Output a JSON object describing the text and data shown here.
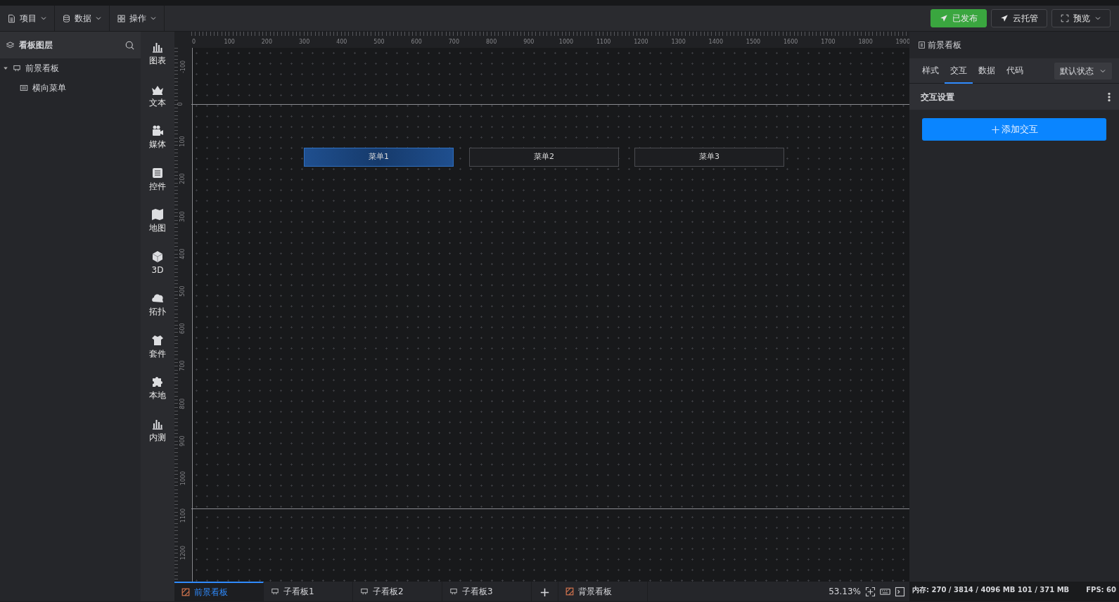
{
  "toolbar": {
    "menus": [
      {
        "label": "项目"
      },
      {
        "label": "数据"
      },
      {
        "label": "操作"
      }
    ],
    "actions": [
      {
        "label": "已发布",
        "kind": "primary"
      },
      {
        "label": "云托管",
        "kind": "outline"
      },
      {
        "label": "预览",
        "kind": "dropdown"
      }
    ]
  },
  "layers": {
    "title": "看板图层",
    "tree": [
      {
        "label": "前景看板",
        "expanded": true,
        "children": [
          {
            "label": "横向菜单"
          }
        ]
      }
    ]
  },
  "palette": [
    {
      "label": "图表"
    },
    {
      "label": "文本"
    },
    {
      "label": "媒体"
    },
    {
      "label": "控件"
    },
    {
      "label": "地图"
    },
    {
      "label": "3D"
    },
    {
      "label": "拓扑"
    },
    {
      "label": "套件"
    },
    {
      "label": "本地"
    },
    {
      "label": "内测"
    }
  ],
  "ruler": {
    "x_labels": [
      "0",
      "100",
      "200",
      "300",
      "400",
      "500",
      "600",
      "700",
      "800",
      "900",
      "1000",
      "1100",
      "1200",
      "1300",
      "1400",
      "1500",
      "1600",
      "1700",
      "1800",
      "1900"
    ],
    "y_labels": [
      "-100",
      "0",
      "100",
      "200",
      "300",
      "400",
      "500",
      "600",
      "700",
      "800",
      "900",
      "1000",
      "1100",
      "1200"
    ]
  },
  "canvas": {
    "menu_items": [
      {
        "label": "菜单1",
        "selected": true
      },
      {
        "label": "菜单2",
        "selected": false
      },
      {
        "label": "菜单3",
        "selected": false
      }
    ]
  },
  "board_tabs": [
    {
      "label": "前景看板",
      "kind": "board",
      "selected": true
    },
    {
      "label": "子看板1",
      "kind": "sub",
      "selected": false
    },
    {
      "label": "子看板2",
      "kind": "sub",
      "selected": false
    },
    {
      "label": "子看板3",
      "kind": "sub",
      "selected": false
    },
    {
      "label": "+",
      "kind": "add"
    },
    {
      "label": "背景看板",
      "kind": "board",
      "selected": false
    }
  ],
  "zoom": "53.13%",
  "panel": {
    "title": "前景看板",
    "tabs": [
      {
        "label": "样式",
        "selected": false
      },
      {
        "label": "交互",
        "selected": true
      },
      {
        "label": "数据",
        "selected": false
      },
      {
        "label": "代码",
        "selected": false
      }
    ],
    "state_select": "默认状态",
    "section": "交互设置",
    "add_button": "添加交互"
  },
  "status": {
    "memory": "内存: 270 / 3814 / 4096 MB  101 / 371 MB",
    "fps": "FPS: 60"
  }
}
